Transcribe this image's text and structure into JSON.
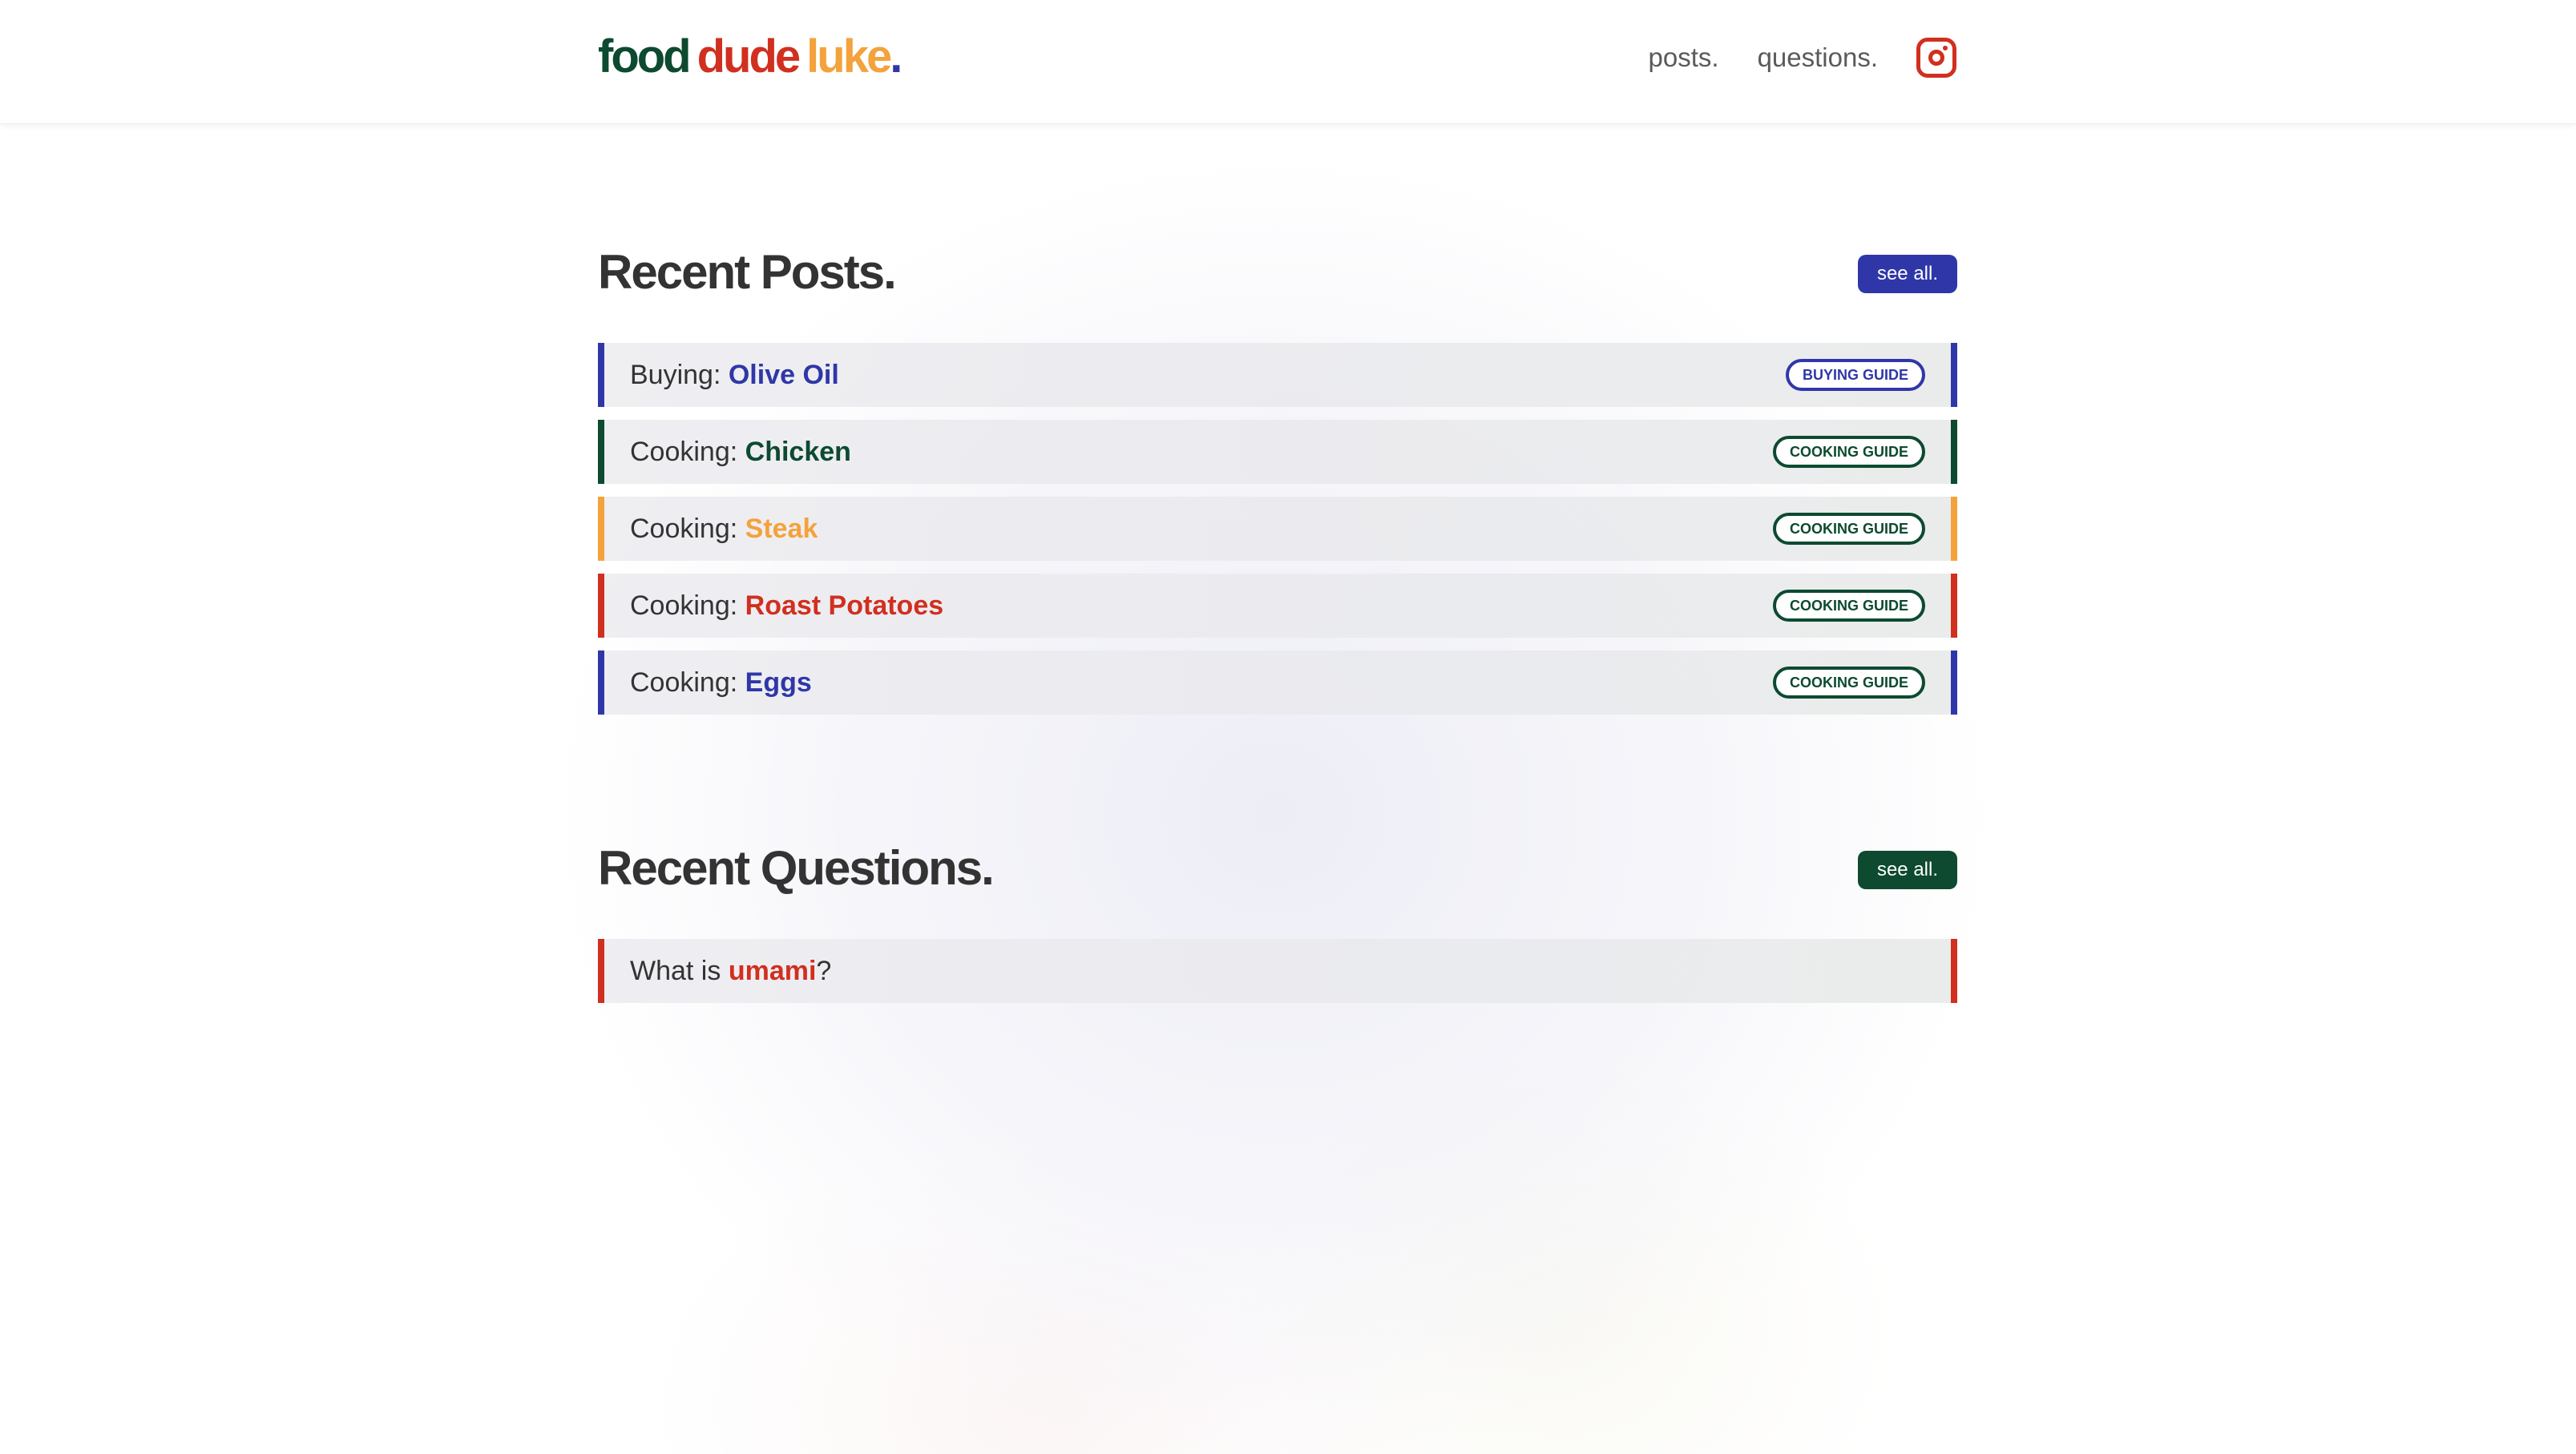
{
  "colors": {
    "green": "#0d4a30",
    "red": "#d12f1f",
    "orange": "#f4a23c",
    "blue": "#2f37a8",
    "heading": "#333333",
    "nav_text": "#5a5a5a"
  },
  "header": {
    "logo": {
      "word1": "food",
      "word2": "dude",
      "word3": "luke",
      "dot": "."
    },
    "nav": {
      "posts": "posts.",
      "questions": "questions.",
      "instagram_icon": "instagram-icon"
    }
  },
  "recent_posts": {
    "title": "Recent Posts.",
    "see_all": "see all.",
    "items": [
      {
        "prefix": "Buying: ",
        "highlight": "Olive Oil",
        "badge": "BUYING GUIDE",
        "accent": "#2f37a8",
        "badge_color": "#2f37a8"
      },
      {
        "prefix": "Cooking: ",
        "highlight": "Chicken",
        "badge": "COOKING GUIDE",
        "accent": "#0d4a30",
        "badge_color": "#0d4a30"
      },
      {
        "prefix": "Cooking: ",
        "highlight": "Steak",
        "badge": "COOKING GUIDE",
        "accent": "#f4a23c",
        "badge_color": "#0d4a30"
      },
      {
        "prefix": "Cooking: ",
        "highlight": "Roast Potatoes",
        "badge": "COOKING GUIDE",
        "accent": "#d12f1f",
        "badge_color": "#0d4a30"
      },
      {
        "prefix": "Cooking: ",
        "highlight": "Eggs",
        "badge": "COOKING GUIDE",
        "accent": "#2f37a8",
        "badge_color": "#0d4a30"
      }
    ]
  },
  "recent_questions": {
    "title": "Recent Questions.",
    "see_all": "see all.",
    "items": [
      {
        "prefix": "What is ",
        "highlight": "umami",
        "suffix": "?",
        "accent": "#d12f1f"
      }
    ]
  }
}
